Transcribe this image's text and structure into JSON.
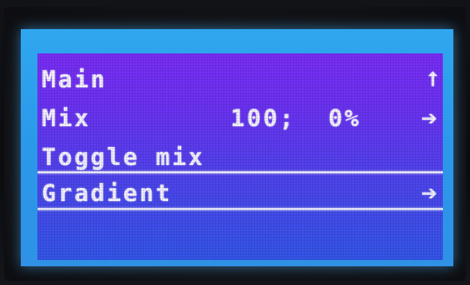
{
  "menu": {
    "items": [
      {
        "label": "Main",
        "value": "",
        "arrow": "⭡"
      },
      {
        "label": "Mix",
        "value": "100;  0%",
        "arrow": "➔"
      },
      {
        "label": "Toggle mix",
        "value": "",
        "arrow": ""
      },
      {
        "label": "Gradient",
        "value": "",
        "arrow": "➔"
      }
    ],
    "selected_index": 3
  },
  "colors": {
    "lcd_top": "#7a2df5",
    "lcd_bottom": "#3356e8",
    "backlight": "#2fa7ef",
    "text": "#f4f2ff"
  }
}
